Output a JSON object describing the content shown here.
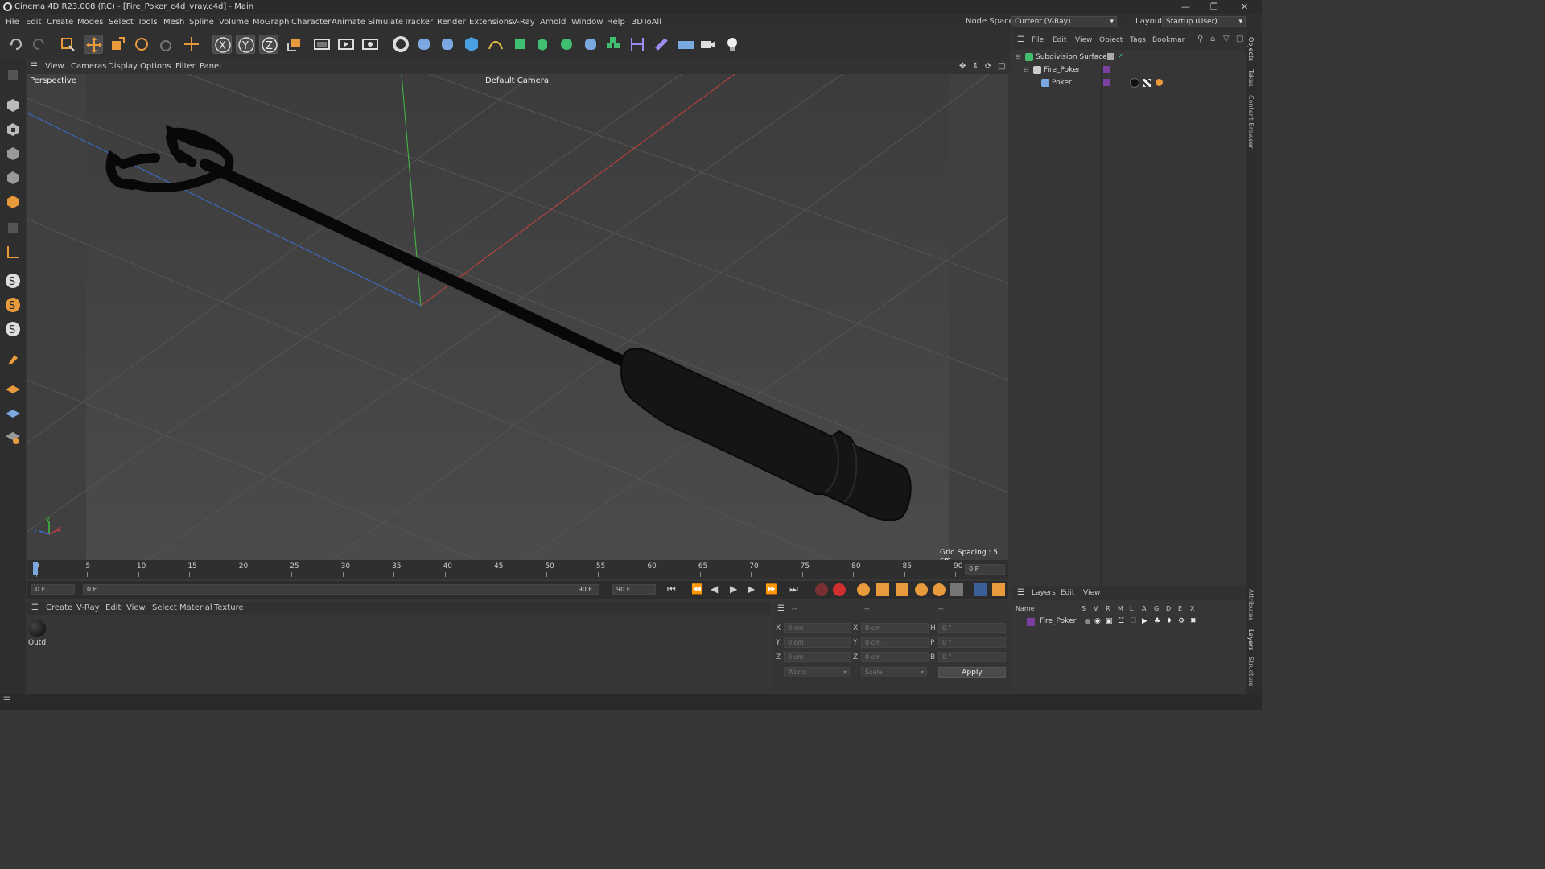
{
  "window": {
    "title": "Cinema 4D R23.008 (RC) - [Fire_Poker_c4d_vray.c4d] - Main"
  },
  "menu": [
    "File",
    "Edit",
    "Create",
    "Modes",
    "Select",
    "Tools",
    "Mesh",
    "Spline",
    "Volume",
    "MoGraph",
    "Character",
    "Animate",
    "Simulate",
    "Tracker",
    "Render",
    "Extensions",
    "V-Ray",
    "Arnold",
    "Window",
    "Help",
    "3DToAll"
  ],
  "nodespace": {
    "label": "Node Space:",
    "value": "Current (V-Ray)"
  },
  "layout": {
    "label": "Layout:",
    "value": "Startup (User)"
  },
  "viewport": {
    "menu": [
      "View",
      "Cameras",
      "Display",
      "Options",
      "Filter",
      "Panel"
    ],
    "name": "Perspective",
    "camera": "Default Camera",
    "grid": "Grid Spacing : 5 cm",
    "axis_x": "X",
    "axis_y": "Y",
    "axis_z": "Z"
  },
  "timeline": {
    "ticks": [
      "0",
      "5",
      "10",
      "15",
      "20",
      "25",
      "30",
      "35",
      "40",
      "45",
      "50",
      "55",
      "60",
      "65",
      "70",
      "75",
      "80",
      "85",
      "90"
    ],
    "current": "0 F",
    "start": "0 F",
    "range_start": "0 F",
    "range_end": "90 F",
    "end": "90 F"
  },
  "material": {
    "menu": [
      "Create",
      "V-Ray",
      "Edit",
      "View",
      "Select",
      "Material",
      "Texture"
    ],
    "items": [
      {
        "name": "Outd"
      }
    ]
  },
  "coords": {
    "header": [
      "--",
      "--",
      "--"
    ],
    "rows": [
      {
        "a": "X",
        "av": "0 cm",
        "b": "X",
        "bv": "0 cm",
        "c": "H",
        "cv": "0 °"
      },
      {
        "a": "Y",
        "av": "0 cm",
        "b": "Y",
        "bv": "0 cm",
        "c": "P",
        "cv": "0 °"
      },
      {
        "a": "Z",
        "av": "0 cm",
        "b": "Z",
        "bv": "0 cm",
        "c": "B",
        "cv": "0 °"
      }
    ],
    "mode1": "World",
    "mode2": "Scale",
    "apply": "Apply"
  },
  "objects": {
    "menu": [
      "File",
      "Edit",
      "View",
      "Object",
      "Tags",
      "Bookmar"
    ],
    "items": [
      {
        "name": "Subdivision Surface"
      },
      {
        "name": "Fire_Poker"
      },
      {
        "name": "Poker"
      }
    ]
  },
  "layers": {
    "menu": [
      "Layers",
      "Edit",
      "View"
    ],
    "cols": [
      "Name",
      "S",
      "V",
      "R",
      "M",
      "L",
      "A",
      "G",
      "D",
      "E",
      "X"
    ],
    "items": [
      {
        "name": "Fire_Poker"
      }
    ]
  },
  "righttabs": [
    "Objects",
    "Takes",
    "Content Browser",
    "Attributes",
    "Layers",
    "Structure"
  ],
  "colors": {
    "x_axis": "#c84040",
    "y_axis": "#40c040",
    "z_axis": "#3c6fd0",
    "layer": "#7a3fa0"
  }
}
